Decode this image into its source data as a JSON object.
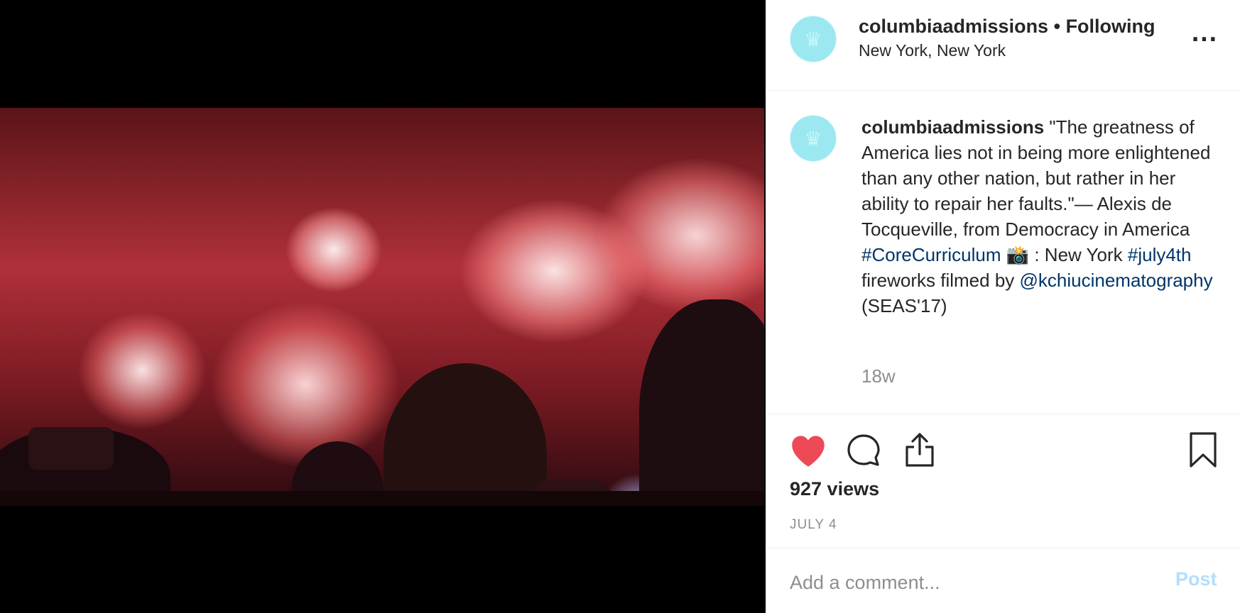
{
  "media": {
    "type": "video",
    "description_icon": "fireworks-video"
  },
  "header": {
    "username": "columbiaadmissions",
    "separator": "•",
    "follow_status": "Following",
    "location": "New York, New York",
    "more_icon": "more-horizontal-icon",
    "more_label": "..."
  },
  "caption": {
    "username": "columbiaadmissions",
    "text_part1": "\"The greatness of America lies not in being more enlightened than any other nation, but rather in her ability to repair her faults.\"— Alexis de Tocqueville, from Democracy in America",
    "hashtag1": "#CoreCurriculum",
    "camera_emoji": "📸",
    "text_part2": ": New York",
    "hashtag2": "#july4th",
    "text_part3": "fireworks filmed by",
    "mention": "@kchiucinematography",
    "text_part4": "(SEAS'17)",
    "time_ago": "18w"
  },
  "actions": {
    "like_icon": "heart-filled-icon",
    "comment_icon": "comment-icon",
    "share_icon": "share-icon",
    "save_icon": "bookmark-icon",
    "liked": true,
    "views": "927 views",
    "date": "JULY 4"
  },
  "comment_box": {
    "placeholder": "Add a comment...",
    "value": "",
    "post_label": "Post"
  },
  "colors": {
    "like": "#ed4956",
    "link": "#003569",
    "muted": "#8e8e8e",
    "post_disabled": "#b2dffc",
    "avatar": "#9ce8f0"
  }
}
